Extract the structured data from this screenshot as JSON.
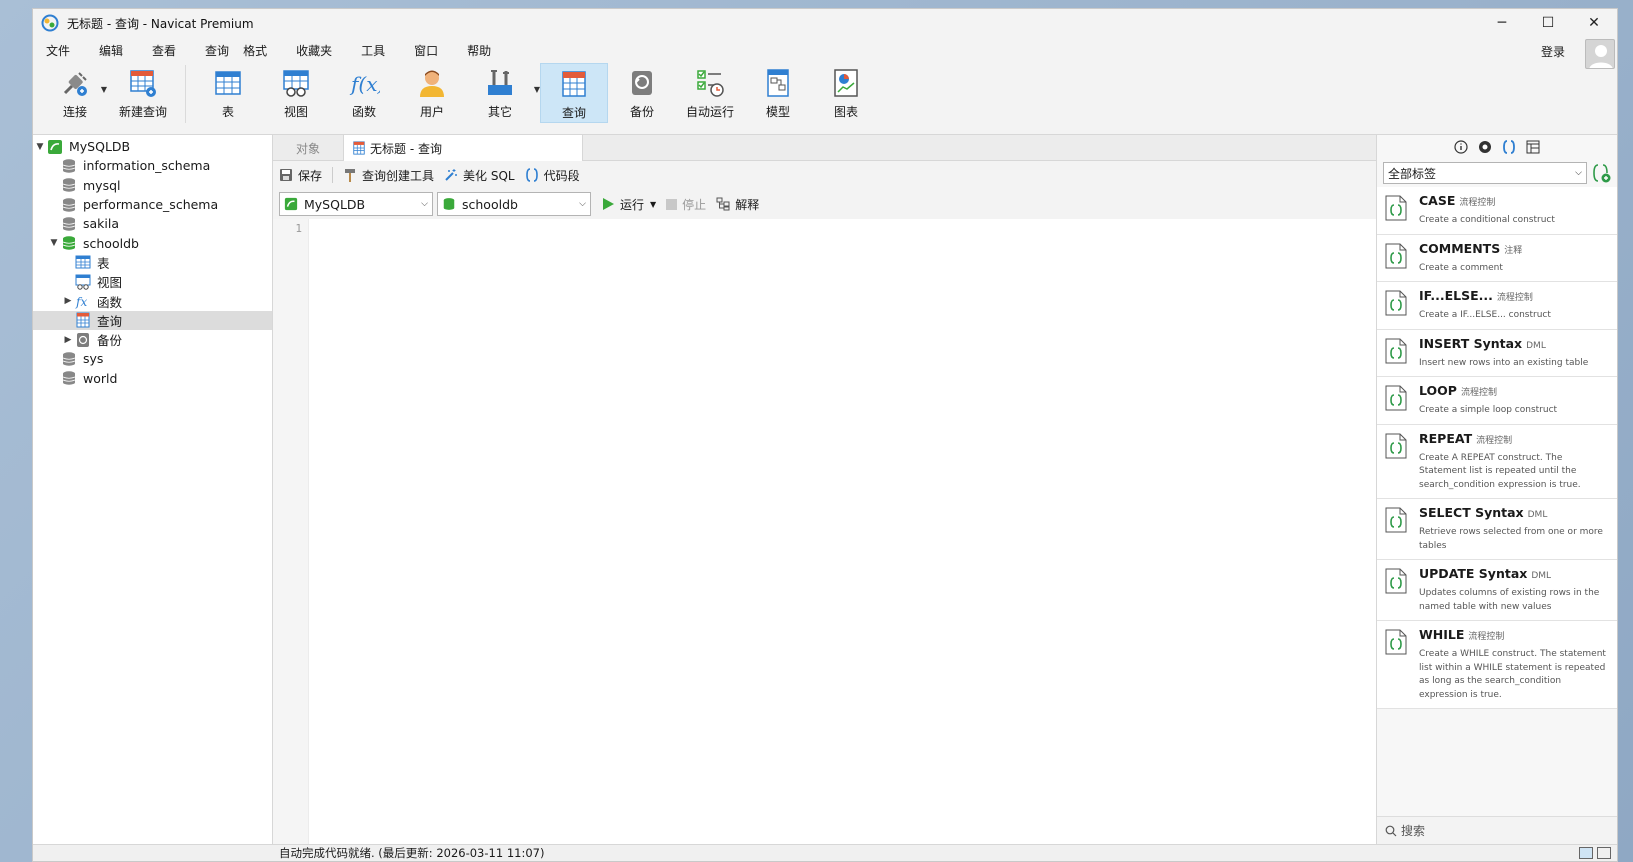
{
  "window": {
    "title": "无标题 - 查询 - Navicat Premium",
    "controls": [
      "─",
      "☐",
      "✕"
    ]
  },
  "menu": {
    "items": [
      "文件",
      "编辑",
      "查看",
      "查询",
      "格式",
      "收藏夹",
      "工具",
      "窗口",
      "帮助"
    ],
    "login": "登录"
  },
  "toolbar": {
    "buttons": [
      {
        "label": "连接",
        "icon": "plug-icon"
      },
      {
        "label": "新建查询",
        "icon": "new-query-icon"
      },
      {
        "label": "表",
        "icon": "table-icon"
      },
      {
        "label": "视图",
        "icon": "view-icon"
      },
      {
        "label": "函数",
        "icon": "function-icon"
      },
      {
        "label": "用户",
        "icon": "user-icon"
      },
      {
        "label": "其它",
        "icon": "tools-icon"
      },
      {
        "label": "查询",
        "icon": "query-icon"
      },
      {
        "label": "备份",
        "icon": "backup-icon"
      },
      {
        "label": "自动运行",
        "icon": "automation-icon"
      },
      {
        "label": "模型",
        "icon": "model-icon"
      },
      {
        "label": "图表",
        "icon": "chart-icon"
      }
    ],
    "active": "查询"
  },
  "tree": {
    "connection": "MySQLDB",
    "databases": [
      "information_schema",
      "mysql",
      "performance_schema",
      "sakila",
      "schooldb",
      "sys",
      "world"
    ],
    "schooldb_children": [
      "表",
      "视图",
      "函数",
      "查询",
      "备份"
    ],
    "selected": "查询"
  },
  "tabs": {
    "objects": "对象",
    "query_tab": "无标题 - 查询"
  },
  "query_toolbar": {
    "save": "保存",
    "builder": "查询创建工具",
    "beautify": "美化 SQL",
    "snippet": "代码段"
  },
  "selectors": {
    "connection": "MySQLDB",
    "database": "schooldb",
    "run": "运行",
    "stop": "停止",
    "explain": "解释"
  },
  "editor": {
    "line_numbers": [
      "1"
    ]
  },
  "right_panel": {
    "filter": "全部标签",
    "search_placeholder": "搜索",
    "snippets": [
      {
        "title": "CASE",
        "tag": "流程控制",
        "desc": "Create a conditional construct"
      },
      {
        "title": "COMMENTS",
        "tag": "注释",
        "desc": "Create a comment"
      },
      {
        "title": "IF...ELSE...",
        "tag": "流程控制",
        "desc": "Create a IF...ELSE... construct"
      },
      {
        "title": "INSERT Syntax",
        "tag": "DML",
        "desc": "Insert new rows into an existing table"
      },
      {
        "title": "LOOP",
        "tag": "流程控制",
        "desc": "Create a simple loop construct"
      },
      {
        "title": "REPEAT",
        "tag": "流程控制",
        "desc": "Create A REPEAT construct. The Statement list is repeated until the search_condition expression is true."
      },
      {
        "title": "SELECT Syntax",
        "tag": "DML",
        "desc": "Retrieve rows selected from one or more tables"
      },
      {
        "title": "UPDATE Syntax",
        "tag": "DML",
        "desc": "Updates columns of existing rows in the named table with new values"
      },
      {
        "title": "WHILE",
        "tag": "流程控制",
        "desc": "Create a WHILE construct. The statement list within a WHILE statement is repeated as long as the search_condition expression is true."
      }
    ]
  },
  "status": {
    "text": "自动完成代码就绪. (最后更新: 2026-03-11 11:07)"
  },
  "colors": {
    "accent": "#cde6f7",
    "db_green": "#3aa93a",
    "snippet_icon": "#2e9a48"
  }
}
